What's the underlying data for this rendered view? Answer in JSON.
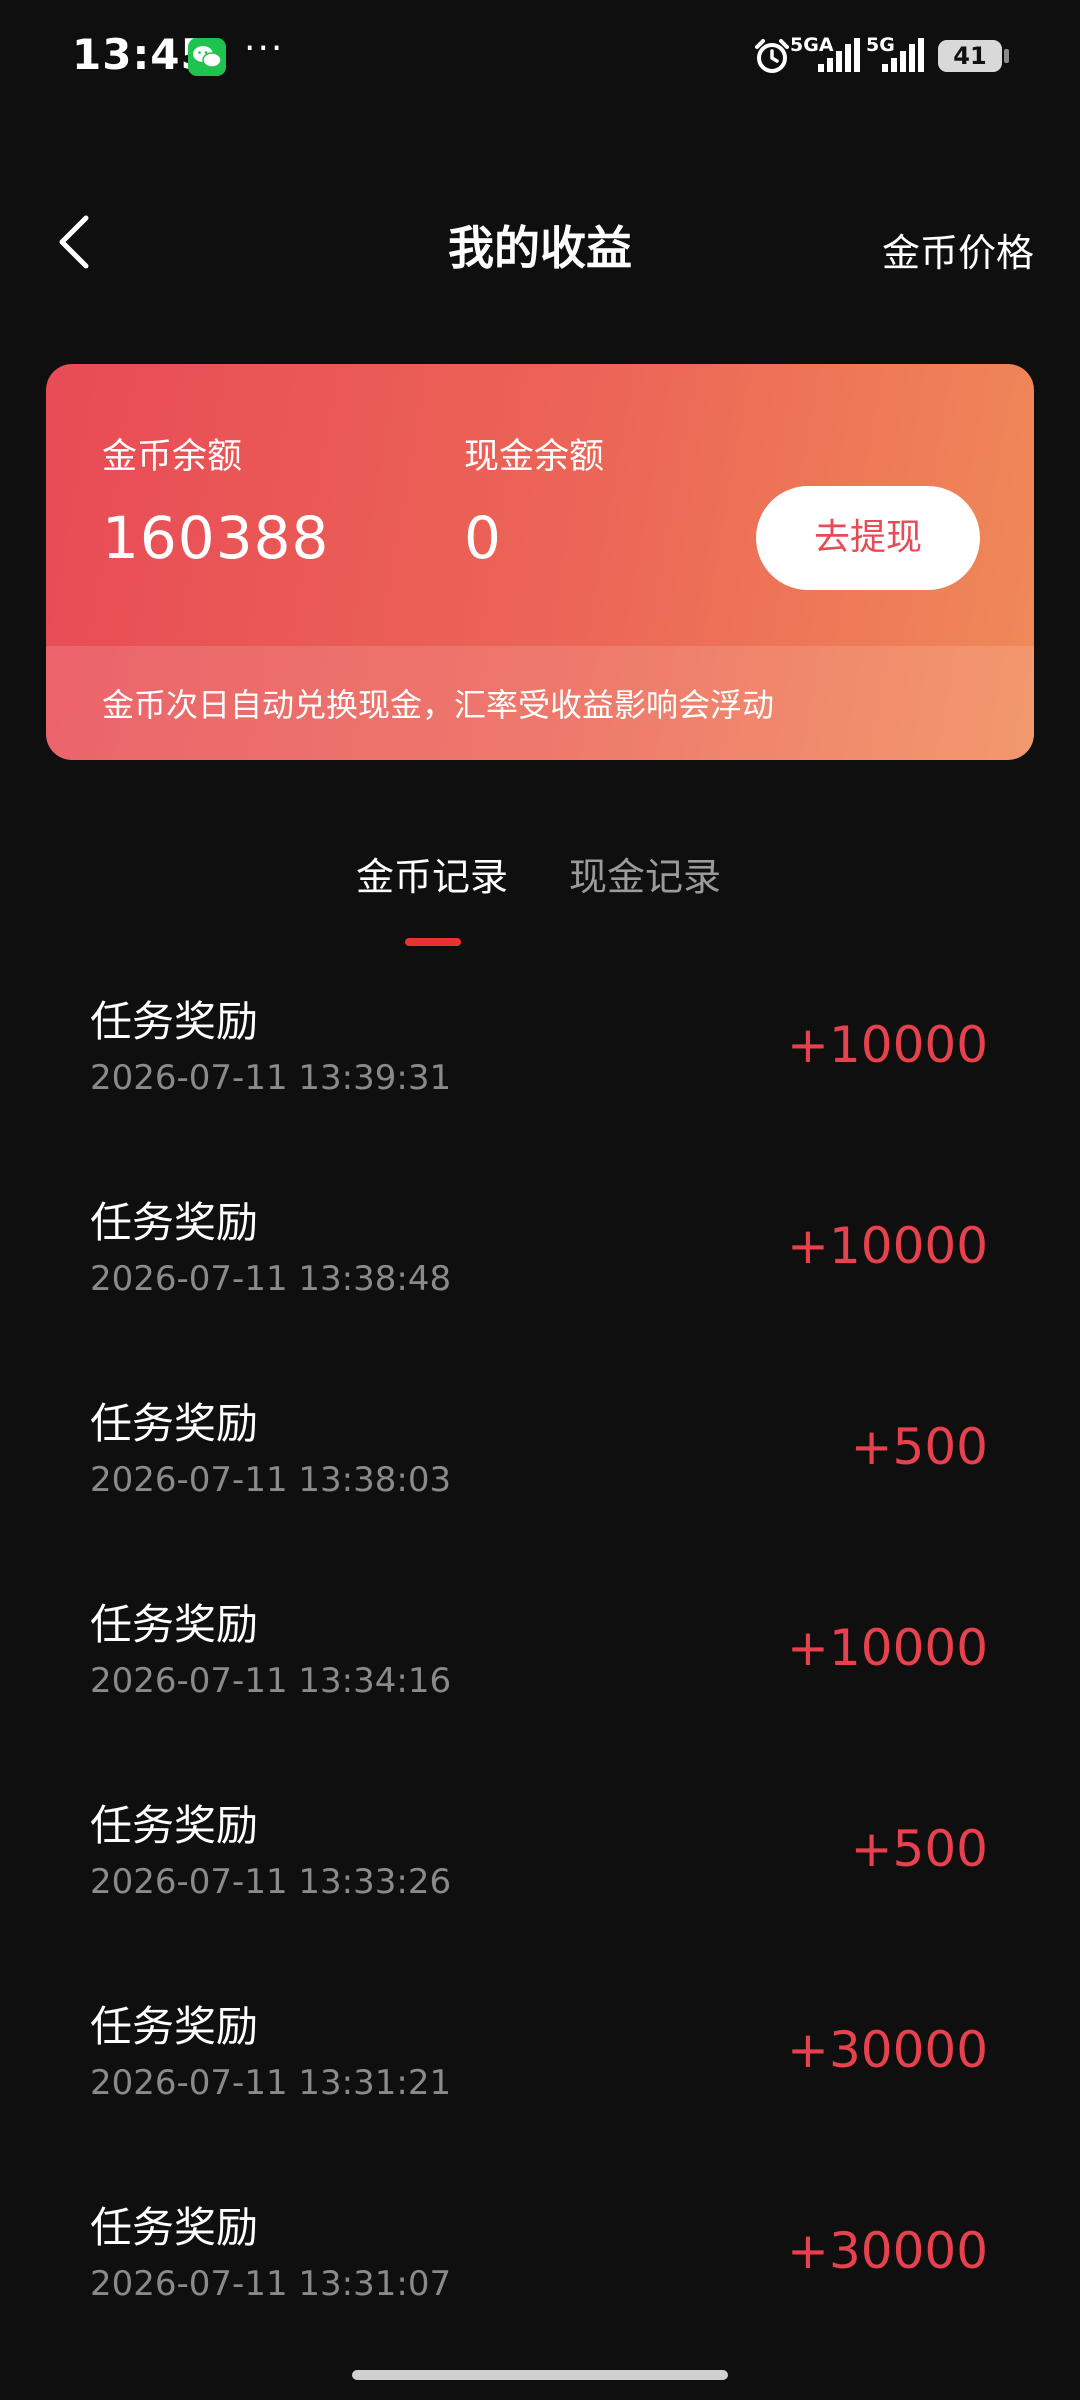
{
  "status_bar": {
    "time": "13:45",
    "more": "···",
    "network_1": "5GA",
    "network_2": "5G",
    "battery": "41"
  },
  "header": {
    "title": "我的收益",
    "right_link": "金币价格"
  },
  "balance_card": {
    "coin_label": "金币余额",
    "coin_value": "160388",
    "cash_label": "现金余额",
    "cash_value": "0",
    "withdraw_label": "去提现",
    "note": "金币次日自动兑换现金，汇率受收益影响会浮动"
  },
  "tabs": [
    {
      "label": "金币记录",
      "active": true
    },
    {
      "label": "现金记录",
      "active": false
    }
  ],
  "records": [
    {
      "title": "任务奖励",
      "time": "2026-07-11 13:39:31",
      "amount": "+10000"
    },
    {
      "title": "任务奖励",
      "time": "2026-07-11 13:38:48",
      "amount": "+10000"
    },
    {
      "title": "任务奖励",
      "time": "2026-07-11 13:38:03",
      "amount": "+500"
    },
    {
      "title": "任务奖励",
      "time": "2026-07-11 13:34:16",
      "amount": "+10000"
    },
    {
      "title": "任务奖励",
      "time": "2026-07-11 13:33:26",
      "amount": "+500"
    },
    {
      "title": "任务奖励",
      "time": "2026-07-11 13:31:21",
      "amount": "+30000"
    },
    {
      "title": "任务奖励",
      "time": "2026-07-11 13:31:07",
      "amount": "+30000"
    }
  ],
  "colors": {
    "background": "#0f0f0f",
    "accent": "#e8414e",
    "card_gradient_start": "#e84b55",
    "card_gradient_end": "#f08a58",
    "tab_indicator": "#e8332f"
  },
  "icons": {
    "back": "chevron-left-icon",
    "wechat": "wechat-icon",
    "alarm": "alarm-icon",
    "signal": "signal-icon",
    "battery": "battery-icon"
  }
}
